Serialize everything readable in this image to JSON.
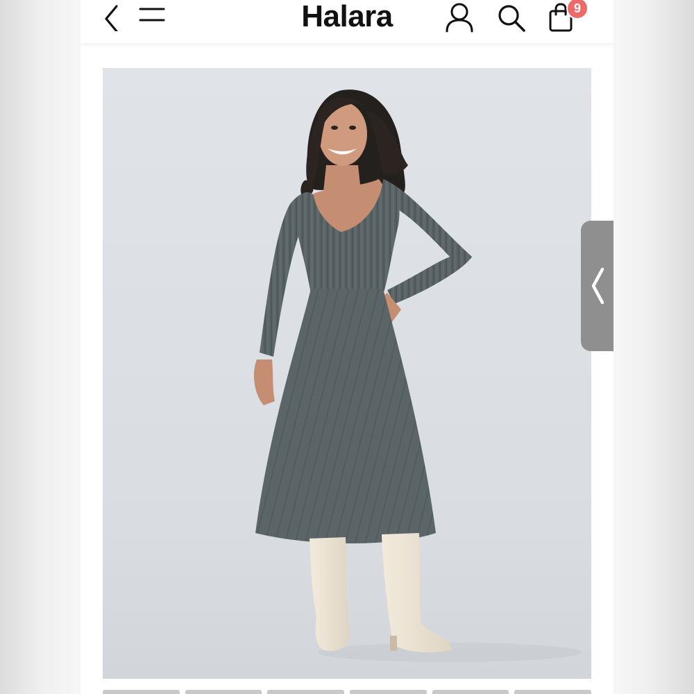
{
  "header": {
    "brand": "Halara",
    "cart_count": "9",
    "icons": {
      "back": "chevron-left-icon",
      "menu": "hamburger-menu-icon",
      "account": "user-icon",
      "search": "search-icon",
      "cart": "shopping-bag-icon"
    }
  },
  "product": {
    "image": "product-photo",
    "dress_color": "#5d676a",
    "boot_color": "#ece3d3",
    "background_color": "#dbdee2"
  },
  "side_tab": {
    "icon": "chevron-left-icon"
  },
  "colors": {
    "badge": "#ee6a6a",
    "brand_text": "#111111"
  }
}
